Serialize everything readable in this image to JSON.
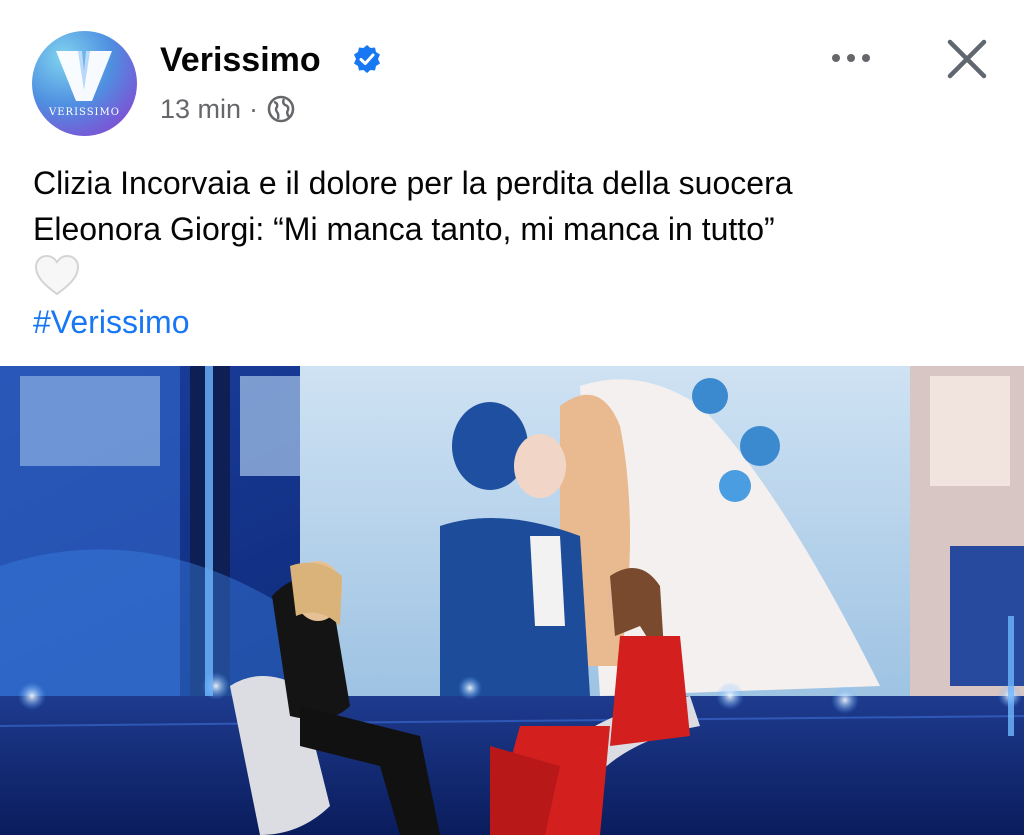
{
  "header": {
    "page_name": "Verissimo",
    "avatar_text": "VERISSIMO",
    "time": "13 min",
    "separator": "·",
    "verified_icon": "verified-badge-icon",
    "privacy_icon": "globe-icon",
    "more_icon": "more-options-icon",
    "close_icon": "close-icon"
  },
  "post": {
    "text_line1": "Clizia Incorvaia e il dolore per la perdita della suocera",
    "text_line2": "Eleonora Giorgi: “Mi manca tanto, mi manca in tutto”",
    "emoji": "white-heart-icon",
    "hashtag": "#Verissimo"
  },
  "colors": {
    "link": "#1877f2",
    "verified": "#1877f2",
    "meta": "#65676b"
  }
}
